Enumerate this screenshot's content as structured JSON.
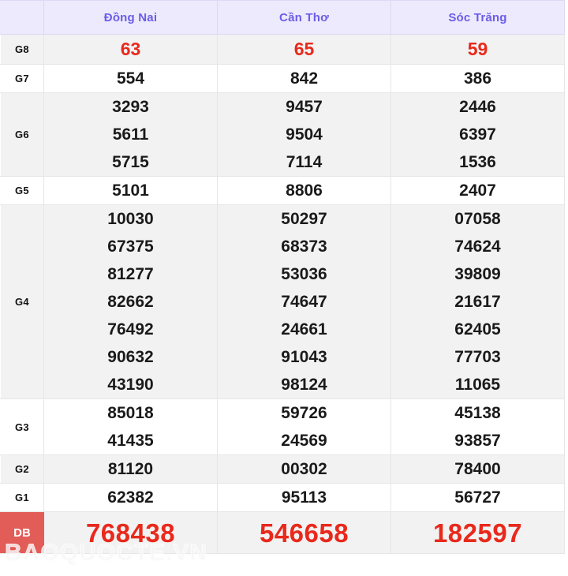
{
  "table": {
    "corner_label": "",
    "provinces": [
      "Đồng Nai",
      "Cần Thơ",
      "Sóc Trăng"
    ],
    "rows": [
      {
        "label": "G8",
        "style": "red",
        "values": [
          [
            "63"
          ],
          [
            "65"
          ],
          [
            "59"
          ]
        ]
      },
      {
        "label": "G7",
        "style": "normal",
        "values": [
          [
            "554"
          ],
          [
            "842"
          ],
          [
            "386"
          ]
        ]
      },
      {
        "label": "G6",
        "style": "normal",
        "values": [
          [
            "3293",
            "5611",
            "5715"
          ],
          [
            "9457",
            "9504",
            "7114"
          ],
          [
            "2446",
            "6397",
            "1536"
          ]
        ]
      },
      {
        "label": "G5",
        "style": "normal",
        "values": [
          [
            "5101"
          ],
          [
            "8806"
          ],
          [
            "2407"
          ]
        ]
      },
      {
        "label": "G4",
        "style": "normal",
        "values": [
          [
            "10030",
            "67375",
            "81277",
            "82662",
            "76492",
            "90632",
            "43190"
          ],
          [
            "50297",
            "68373",
            "53036",
            "74647",
            "24661",
            "91043",
            "98124"
          ],
          [
            "07058",
            "74624",
            "39809",
            "21617",
            "62405",
            "77703",
            "11065"
          ]
        ]
      },
      {
        "label": "G3",
        "style": "normal",
        "values": [
          [
            "85018",
            "41435"
          ],
          [
            "59726",
            "24569"
          ],
          [
            "45138",
            "93857"
          ]
        ]
      },
      {
        "label": "G2",
        "style": "normal",
        "values": [
          [
            "81120"
          ],
          [
            "00302"
          ],
          [
            "78400"
          ]
        ]
      },
      {
        "label": "G1",
        "style": "normal",
        "values": [
          [
            "62382"
          ],
          [
            "95113"
          ],
          [
            "56727"
          ]
        ]
      },
      {
        "label": "DB",
        "style": "special",
        "values": [
          [
            "768438"
          ],
          [
            "546658"
          ],
          [
            "182597"
          ]
        ]
      }
    ]
  },
  "watermark": {
    "text": "BAOQUOCTE.VN"
  },
  "colors": {
    "header_bg": "#eceafc",
    "header_text": "#6c5ce7",
    "red_number": "#e8291c",
    "db_label_bg": "#e25c58",
    "alt_row_bg": "#f2f2f2",
    "plain_row_bg": "#ffffff",
    "border": "#e6e6e6"
  }
}
